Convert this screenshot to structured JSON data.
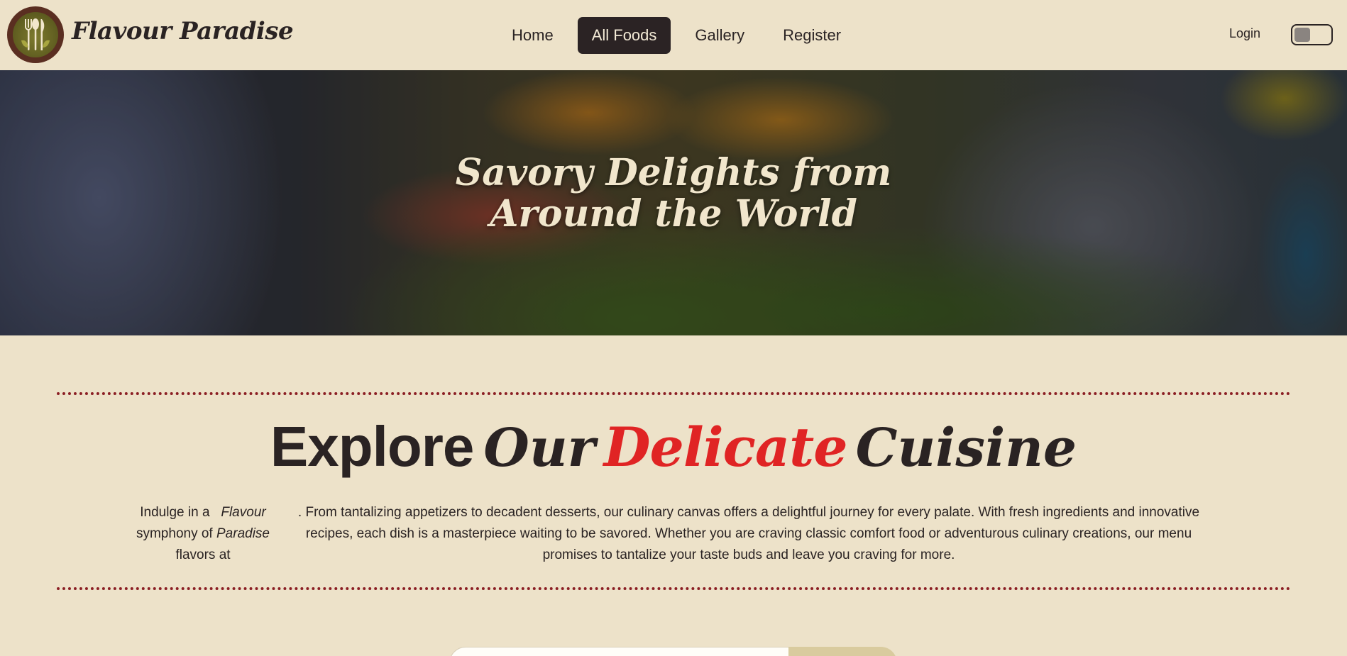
{
  "brand": {
    "name": "Flavour Paradise",
    "logo_icon": "utensils-logo-icon"
  },
  "nav": {
    "items": [
      {
        "label": "Home",
        "active": false
      },
      {
        "label": "All Foods",
        "active": true
      },
      {
        "label": "Gallery",
        "active": false
      },
      {
        "label": "Register",
        "active": false
      }
    ],
    "login_label": "Login",
    "theme_toggle": {
      "icon": "toggle-switch",
      "on": false
    }
  },
  "hero": {
    "title_line1": "Savory Delights from",
    "title_line2": "Around the World"
  },
  "explore": {
    "heading_word1": "Explore",
    "heading_word2": "Our",
    "heading_word3": "Delicate",
    "heading_word4": "Cuisine",
    "left_line1_a": "Indulge in a",
    "left_line1_b": "Flavour",
    "left_line2_a": "symphony of",
    "left_line2_b": "Paradise",
    "left_line3": "flavors at",
    "main_text": ". From tantalizing appetizers to decadent desserts, our culinary canvas offers a delightful journey for every palate. With fresh ingredients and innovative recipes, each dish is a masterpiece waiting to be savored. Whether you are craving classic comfort food or adventurous culinary creations, our menu promises to tantalize your taste buds and leave you craving for more."
  },
  "colors": {
    "background": "#ede2c9",
    "dark": "#2a2323",
    "accent_red": "#e02424",
    "divider": "#8b1f24",
    "logo_ring": "#5a2e21"
  }
}
